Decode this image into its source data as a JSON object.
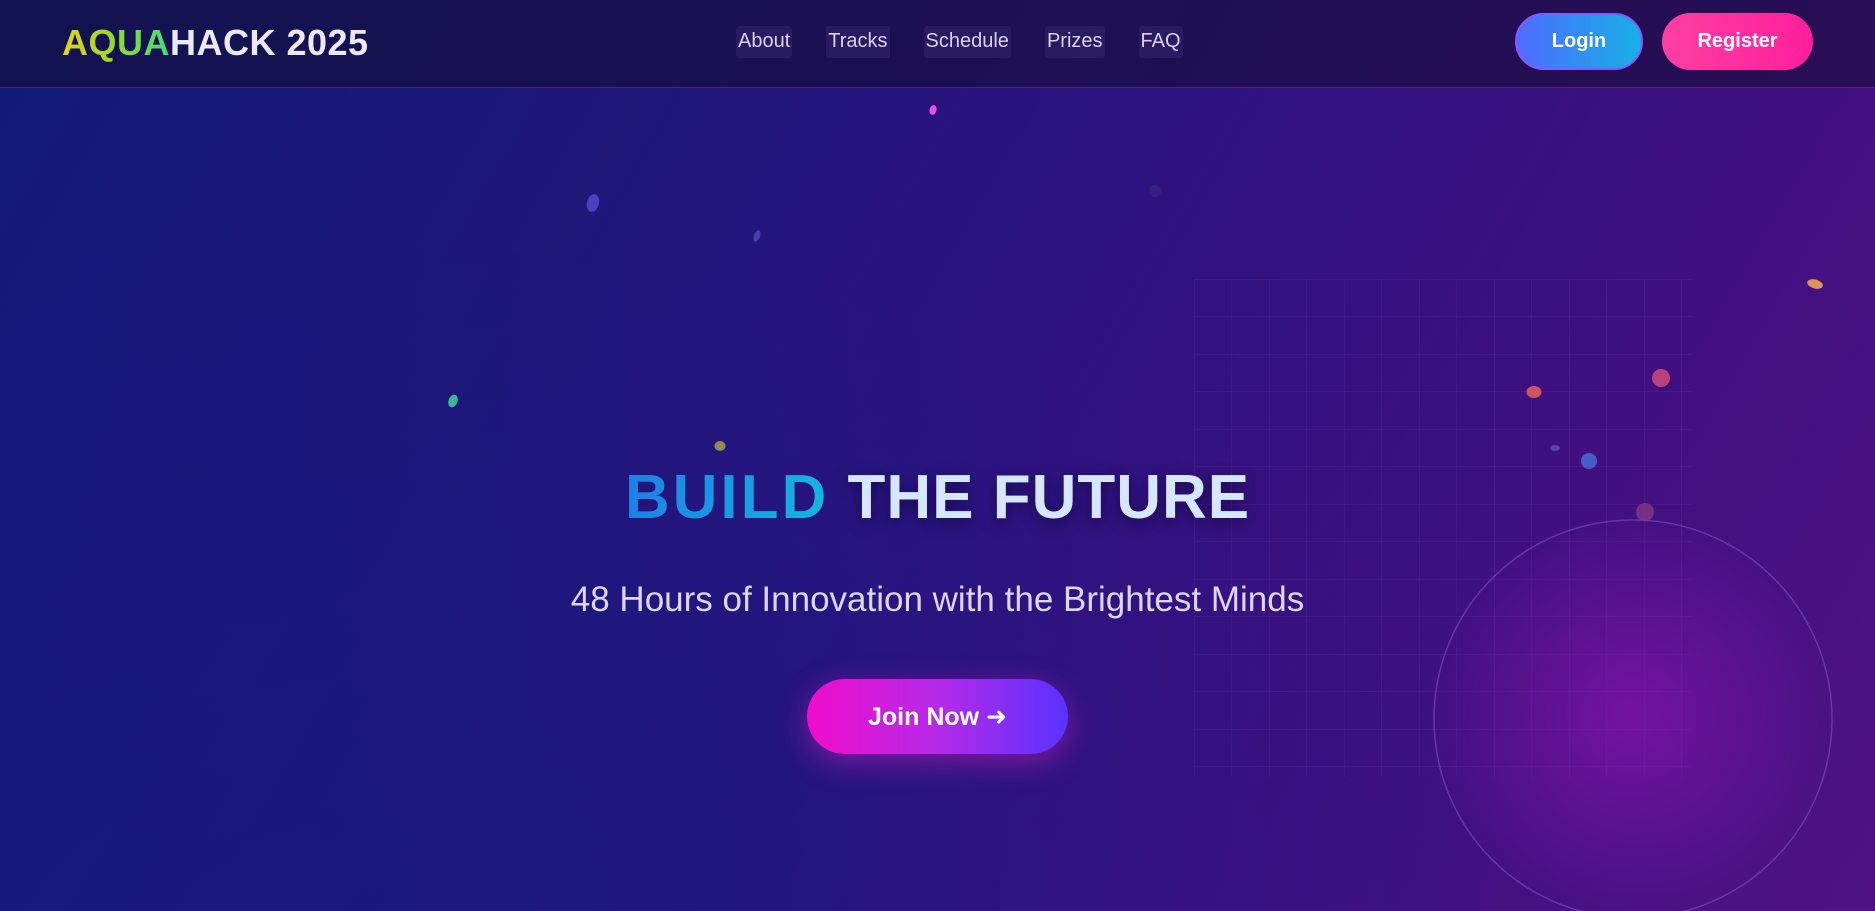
{
  "brand": {
    "logo_part1": "AQUA",
    "logo_part2": "HACK 2025"
  },
  "nav": {
    "links": [
      {
        "label": "About"
      },
      {
        "label": "Tracks"
      },
      {
        "label": "Schedule"
      },
      {
        "label": "Prizes"
      },
      {
        "label": "FAQ"
      }
    ],
    "login_label": "Login",
    "register_label": "Register"
  },
  "hero": {
    "title_accent": "BUILD",
    "title_rest": "THE FUTURE",
    "subtitle": "48 Hours of Innovation with the Brightest Minds",
    "cta_label": "Join Now ➜"
  },
  "colors": {
    "background_start": "#111a78",
    "background_end": "#4e1284",
    "accent_blue": "#14b6e0",
    "accent_pink": "#ff1f9c",
    "cta_gradient_start": "#f10ccb",
    "cta_gradient_end": "#5a32ff"
  },
  "icons": {
    "cta_arrow": "arrow-right-icon"
  }
}
